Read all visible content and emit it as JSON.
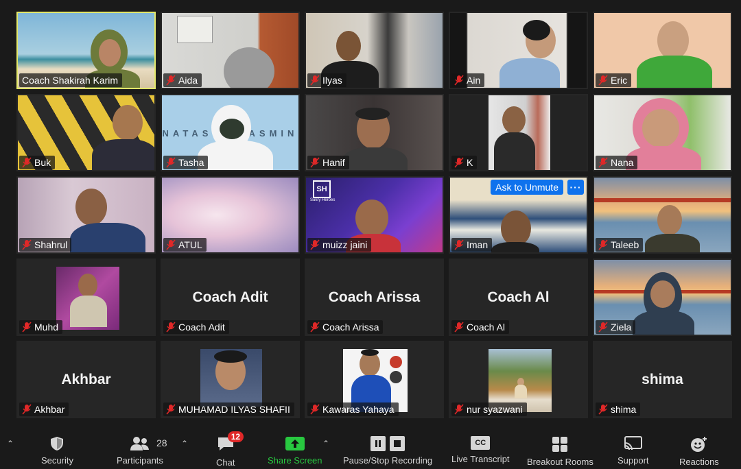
{
  "participants": [
    {
      "name": "Coach Shakirah Karim",
      "video": true
    },
    {
      "name": "Aida",
      "video": true
    },
    {
      "name": "Ilyas",
      "video": true
    },
    {
      "name": "Ain",
      "video": true
    },
    {
      "name": "Eric",
      "video": true
    },
    {
      "name": "Buk",
      "video": true
    },
    {
      "name": "Tasha",
      "video": true
    },
    {
      "name": "Hanif",
      "video": true
    },
    {
      "name": "K",
      "video": true
    },
    {
      "name": "Nana",
      "video": true
    },
    {
      "name": "Shahrul",
      "video": true
    },
    {
      "name": "ATUL",
      "video": true
    },
    {
      "name": "muizz jaini",
      "video": true
    },
    {
      "name": "Iman",
      "video": true
    },
    {
      "name": "Taleeb",
      "video": true
    },
    {
      "name": "Muhd",
      "video": true
    },
    {
      "name": "Coach Adit",
      "video": false,
      "display": "Coach Adit"
    },
    {
      "name": "Coach Arissa",
      "video": false,
      "display": "Coach Arissa"
    },
    {
      "name": "Coach Al",
      "video": false,
      "display": "Coach Al"
    },
    {
      "name": "Ziela",
      "video": true
    },
    {
      "name": "Akhbar",
      "video": false,
      "display": "Akhbar"
    },
    {
      "name": "MUHAMAD ILYAS SHAFII",
      "video": true
    },
    {
      "name": "Kawaras Yahaya",
      "video": true
    },
    {
      "name": "nur syazwani",
      "video": true
    },
    {
      "name": "shima",
      "video": false,
      "display": "shima"
    }
  ],
  "hover": {
    "ask_unmute": "Ask to Unmute",
    "more": "···"
  },
  "background_text": {
    "tasha_banner": "NATASHA YASMIN",
    "muizz_logo": "SH",
    "muizz_logo_sub": "Sukry Heroes"
  },
  "toolbar": {
    "security": "Security",
    "participants": "Participants",
    "participants_count": "28",
    "chat": "Chat",
    "chat_badge": "12",
    "share_screen": "Share Screen",
    "recording": "Pause/Stop Recording",
    "transcript": "Live Transcript",
    "transcript_icon": "CC",
    "breakout": "Breakout Rooms",
    "support": "Support",
    "reactions": "Reactions"
  },
  "colors": {
    "active_speaker_border": "#e3e86b",
    "accent_blue": "#0e72ed",
    "share_green": "#28c840",
    "mute_red": "#e02828"
  }
}
